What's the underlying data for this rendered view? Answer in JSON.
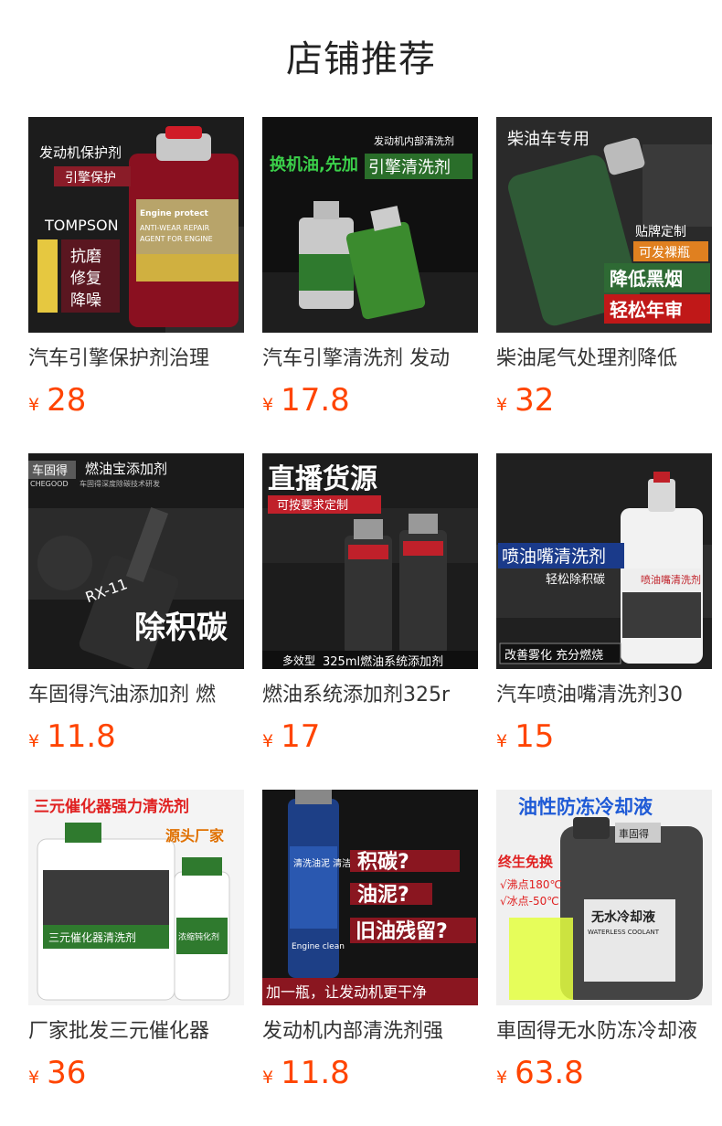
{
  "section_title": "店铺推荐",
  "currency_symbol": "¥",
  "products": [
    {
      "name": "汽车引擎保护剂治理",
      "price": "28",
      "image_text": {
        "top": "发动机保护剂",
        "tag": "引擎保护",
        "brand": "TOMPSON",
        "side": [
          "抗磨",
          "修复",
          "降噪"
        ],
        "label_en1": "ANTI-WEAR REPAIR",
        "label_en2": "AGENT FOR ENGINE",
        "label_en3": "Engine protect"
      }
    },
    {
      "name": "汽车引擎清洗剂 发动",
      "price": "17.8",
      "image_text": {
        "top": "发动机内部清洗剂",
        "left": "换机油,先加",
        "tag": "引擎清洗剂"
      }
    },
    {
      "name": "柴油尾气处理剂降低",
      "price": "32",
      "image_text": {
        "top": "柴油车专用",
        "tag1": "贴牌定制",
        "tag2": "可发裸瓶",
        "tag3": "降低黑烟",
        "tag4": "轻松年审"
      }
    },
    {
      "name": "车固得汽油添加剂 燃",
      "price": "11.8",
      "image_text": {
        "brand": "车固得",
        "brand_en": "CHEGOOD",
        "top": "燃油宝添加剂",
        "sub": "车固得深度除碳技术研发",
        "bottle": "RX-11",
        "big": "除积碳"
      }
    },
    {
      "name": "燃油系统添加剂325r",
      "price": "17",
      "image_text": {
        "top": "直播货源",
        "tag": "可按要求定制",
        "bottom_tag": "多效型",
        "bottom": "325ml燃油系统添加剂"
      }
    },
    {
      "name": "汽车喷油嘴清洗剂30",
      "price": "15",
      "image_text": {
        "top": "喷油嘴清洗剂",
        "sub": "轻松除积碳",
        "label": "喷油嘴清洗剂",
        "bottom": "改善雾化 充分燃烧"
      }
    },
    {
      "name": "厂家批发三元催化器",
      "price": "36",
      "image_text": {
        "top": "三元催化器强力清洗剂",
        "sub": "源头厂家",
        "label1": "三元催化器清洗剂",
        "label2": "浓缩钝化剂"
      }
    },
    {
      "name": "发动机内部清洗剂强",
      "price": "11.8",
      "image_text": {
        "q1": "积碳?",
        "q2": "油泥?",
        "q3": "旧油残留?",
        "bottom": "加一瓶，让发动机更干净",
        "can": "清洗油泥 清洁积碳 保护引擎",
        "can_en": "Engine clean"
      }
    },
    {
      "name": "車固得无水防冻冷却液",
      "price": "63.8",
      "image_text": {
        "top": "油性防冻冷却液",
        "tag": "终生免换",
        "p1": "√沸点180℃",
        "p2": "√冰点-50℃",
        "brand": "車固得",
        "label": "无水冷却液",
        "label_en": "WATERLESS COOLANT"
      }
    }
  ]
}
